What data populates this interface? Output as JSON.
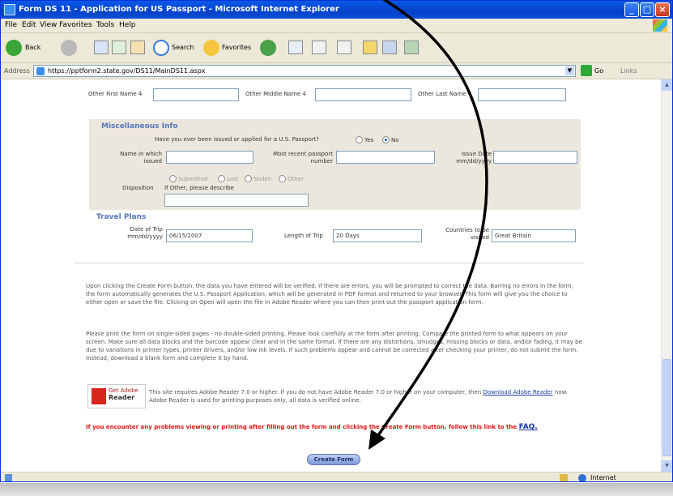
{
  "window": {
    "title": "Form DS 11 - Application for US Passport - Microsoft Internet Explorer"
  },
  "menu": [
    "File",
    "Edit",
    "View",
    "Favorites",
    "Tools",
    "Help"
  ],
  "toolbar": {
    "back": "Back",
    "search": "Search",
    "favorites": "Favorites"
  },
  "address": {
    "label": "Address",
    "url": "https://pptform2.state.gov/DS11/MainDS11.aspx",
    "go": "Go",
    "links": "Links"
  },
  "form": {
    "other_names": {
      "first_label": "Other First Name 4",
      "middle_label": "Other Middle Name 4",
      "last_label": "Other Last Name 4",
      "first_value": "",
      "middle_value": "",
      "last_value": ""
    },
    "misc": {
      "title": "Miscellaneous Info",
      "question": "Have you ever been issued or applied for a U.S. Passport?",
      "yes": "Yes",
      "no": "No",
      "name_label": "Name in which issued",
      "number_label": "Most recent passport number",
      "issue_label": "Issue Date mm/dd/yyyy",
      "disposition_options": [
        "Submitted",
        "Lost",
        "Stolen",
        "Other"
      ],
      "disposition_label": "Disposition",
      "disposition_hint": "If Other, please describe"
    },
    "travel": {
      "title": "Travel Plans",
      "date_label": "Date of Trip mm/dd/yyyy",
      "date_value": "06/15/2007",
      "length_label": "Length of Trip",
      "length_value": "20 Days",
      "countries_label": "Countries to be visited",
      "countries_value": "Great Britain"
    },
    "para1": "Upon clicking the Create Form button, the data you have entered will be verified. If there are errors, you will be prompted to correct the data. Barring no errors in the form, the form automatically generates the U.S. Passport Application, which will be generated in PDF format and returned to your browser. This form will give you the choice to either open or save the file. Clicking on Open will open the file in Adobe Reader where you can then print out the passport application form.",
    "para2": "Please print the form on single-sided pages - no double-sided printing. Please look carefully at the form after printing. Compare the printed form to what appears on your screen. Make sure all data blocks and the barcode appear clear and in the same format. If there are any distortions, smudges, missing blocks or data, and/or fading, it may be due to variations in printer types, printer drivers, and/or low ink levels. If such problems appear and cannot be corrected after checking your printer, do not submit the form. Instead, download a blank form and complete it by hand.",
    "adobe_badge_top": "Get Adobe",
    "adobe_badge_bottom": "Reader",
    "adobe_text": "This site requires Adobe Reader 7.0 or higher. If you do not have Adobe Reader 7.0 or higher on your computer, then ",
    "adobe_link": "Download Adobe Reader",
    "adobe_text2": " now. Adobe Reader is used for printing purposes only, all data is verified online.",
    "warning": "If you encounter any problems viewing or printing after filling out the form and clicking the Create Form button, follow this link to the",
    "faq": "FAQ.",
    "create_button": "Create Form"
  },
  "status": {
    "zone": "Internet"
  },
  "colors": {
    "titlebar": "#0a59e8",
    "panel": "#ece7dc",
    "section_title": "#5577bb",
    "warning": "#e01010",
    "arrow": "#000000"
  }
}
